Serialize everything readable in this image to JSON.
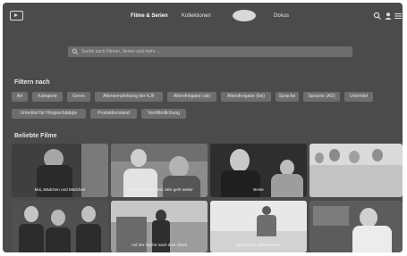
{
  "header": {
    "nav_films": "Filme & Serien",
    "nav_collections": "Kollektionen",
    "nav_docs": "Dokus",
    "icons": [
      "menu-icon",
      "search-icon",
      "user-icon",
      "hamburger-icon"
    ]
  },
  "search": {
    "placeholder": "Suche nach Filmen, Serien und mehr ..."
  },
  "filters": {
    "title": "Filtern nach",
    "row1": [
      "Art",
      "Kategorie",
      "Genre",
      "Altersempfehlung der KJF",
      "Altersfreigabe (ab)",
      "Altersfreigabe (bis)",
      "Sprache",
      "Sprache (AD)",
      "Untertitel"
    ],
    "row2": [
      "Untertitel für Hörgeschädigte",
      "Produktionsland",
      "Veröffentlichung"
    ]
  },
  "popular": {
    "title": "Beliebte Filme",
    "row1": [
      "Mai, Mädchen und Mädchen",
      "Coming Victoria - Ein Jahr geht weiter",
      "Beste",
      ""
    ],
    "row2": [
      "",
      "Auf der Suche nach dem Glück",
      "Was ist ein wahres Haus",
      ""
    ]
  },
  "colors": {
    "screen_bg": "#4b4b4b",
    "chip_bg": "#6e6e6e",
    "search_bg": "#6d6d6d"
  }
}
